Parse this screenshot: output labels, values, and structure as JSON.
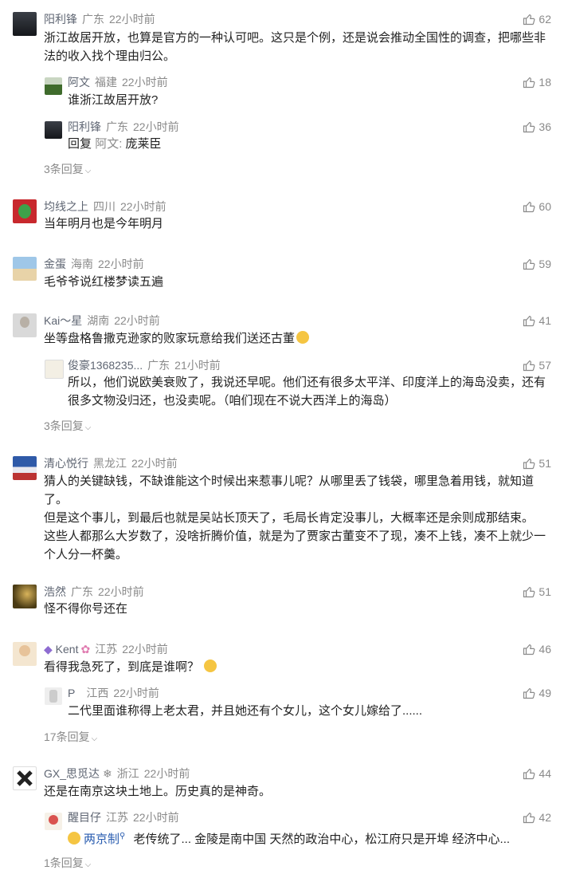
{
  "comments": [
    {
      "name": "阳利锋",
      "region": "广东",
      "time": "22小时前",
      "likes": "62",
      "text": "浙江故居开放，也算是官方的一种认可吧。这只是个例，还是说会推动全国性的调查，把哪些非法的收入找个理由归公。",
      "replies": [
        {
          "name": "阿文",
          "region": "福建",
          "time": "22小时前",
          "likes": "18",
          "text": "谁浙江故居开放?"
        },
        {
          "name": "阳利锋",
          "region": "广东",
          "time": "22小时前",
          "likes": "36",
          "reply_prefix": "回复",
          "reply_to": "阿文:",
          "text": "庞莱臣"
        }
      ],
      "more": "3条回复"
    },
    {
      "name": "均线之上",
      "region": "四川",
      "time": "22小时前",
      "likes": "60",
      "text": "当年明月也是今年明月"
    },
    {
      "name": "金蛋",
      "region": "海南",
      "time": "22小时前",
      "likes": "59",
      "text": "毛爷爷说红楼梦读五遍"
    },
    {
      "name": "Kai～星",
      "region": "湖南",
      "time": "22小时前",
      "likes": "41",
      "text": "坐等盘格鲁撒克逊家的败家玩意给我们送还古董",
      "replies": [
        {
          "name": "俊豪1368235...",
          "region": "广东",
          "time": "21小时前",
          "likes": "57",
          "text": "所以，他们说欧美衰败了，我说还早呢。他们还有很多太平洋、印度洋上的海岛没卖，还有很多文物没归还，也没卖呢。（咱们现在不说大西洋上的海岛）"
        }
      ],
      "more": "3条回复"
    },
    {
      "name": "清心悦行",
      "region": "黑龙江",
      "time": "22小时前",
      "likes": "51",
      "text": "猜人的关键缺钱，不缺谁能这个时候出来惹事儿呢？从哪里丢了钱袋，哪里急着用钱，就知道了。\n但是这个事儿，到最后也就是吴站长顶天了，毛局长肯定没事儿，大概率还是余则成那结束。\n这些人都那么大岁数了，没啥折腾价值，就是为了贾家古董变不了现，凑不上钱，凑不上就少一个人分一杯羹。"
    },
    {
      "name": "浩然",
      "region": "广东",
      "time": "22小时前",
      "likes": "51",
      "text": "怪不得你号还在"
    },
    {
      "name": "Kent",
      "region": "江苏",
      "time": "22小时前",
      "likes": "46",
      "text": "看得我急死了，到底是谁啊？",
      "replies": [
        {
          "name": "P",
          "region": "江西",
          "time": "22小时前",
          "likes": "49",
          "text": "二代里面谁称得上老太君，并且她还有个女儿，这个女儿嫁给了......"
        }
      ],
      "more": "17条回复"
    },
    {
      "name": "GX_思觅达",
      "region": "浙江",
      "time": "22小时前",
      "likes": "44",
      "text": "还是在南京这块土地上。历史真的是神奇。",
      "replies": [
        {
          "name": "醒目仔",
          "region": "江苏",
          "time": "22小时前",
          "likes": "42",
          "reply_to": "两京制",
          "text": "老传统了... 金陵是南中国 天然的政治中心，松江府只是开埠 经济中心..."
        }
      ],
      "more": "1条回复"
    }
  ],
  "icons": {
    "like": "thumbs-up-icon",
    "expand": "chevron-down-icon"
  },
  "colors": {
    "meta": "#8a8a8a",
    "name": "#5f6673",
    "mention": "#2a5db0"
  }
}
